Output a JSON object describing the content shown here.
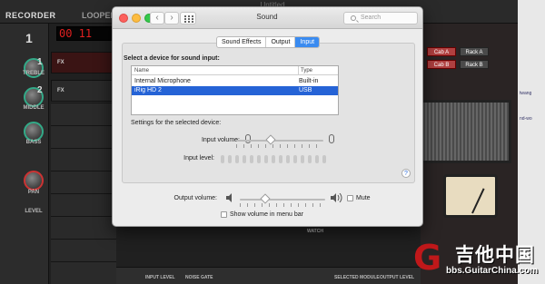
{
  "background_app": {
    "window_title": "Untitled",
    "recorder_title": "RECORDER",
    "looper_title": "LOOPER",
    "counter": "00 11",
    "tracks": [
      {
        "number": "1"
      },
      {
        "number": "2"
      }
    ],
    "knob_labels": [
      "TREBLE",
      "MIDDLE",
      "BASS",
      "PAN",
      "LEVEL"
    ],
    "track_buttons": "FX",
    "cab_labels": [
      "Cab A",
      "Rack A",
      "Cab B",
      "Rack B"
    ],
    "bottom_labels": [
      "INPUT LEVEL",
      "NOISE GATE",
      "SELECTED MODULE",
      "OUTPUT LEVEL"
    ],
    "watch_label": "WATCH",
    "right_side_text": [
      "twang",
      "nd-wo"
    ]
  },
  "dialog": {
    "title": "Sound",
    "search_placeholder": "Search",
    "tabs": [
      {
        "label": "Sound Effects",
        "active": false
      },
      {
        "label": "Output",
        "active": false
      },
      {
        "label": "Input",
        "active": true
      }
    ],
    "select_heading": "Select a device for sound input:",
    "columns": [
      "Name",
      "Type"
    ],
    "devices": [
      {
        "name": "Internal Microphone",
        "type": "Built-in",
        "selected": false
      },
      {
        "name": "iRig HD 2",
        "type": "USB",
        "selected": true
      }
    ],
    "settings_heading": "Settings for the selected device:",
    "input_volume_label": "Input volume:",
    "input_volume_level": 0.4,
    "input_level_label": "Input level:",
    "output_volume_label": "Output volume:",
    "output_volume_level": 0.3,
    "mute_label": "Mute",
    "mute_checked": false,
    "show_volume_label": "Show volume in menu bar",
    "show_volume_checked": false,
    "help_label": "?"
  },
  "watermark": {
    "logo_char": "G",
    "chinese": "吉他中国",
    "url": "bbs.GuitarChina.com"
  },
  "colors": {
    "selection": "#2563d6",
    "tab_active": "#3a8bf0",
    "counter_red": "#e02020",
    "watermark_red": "#c0181a"
  }
}
